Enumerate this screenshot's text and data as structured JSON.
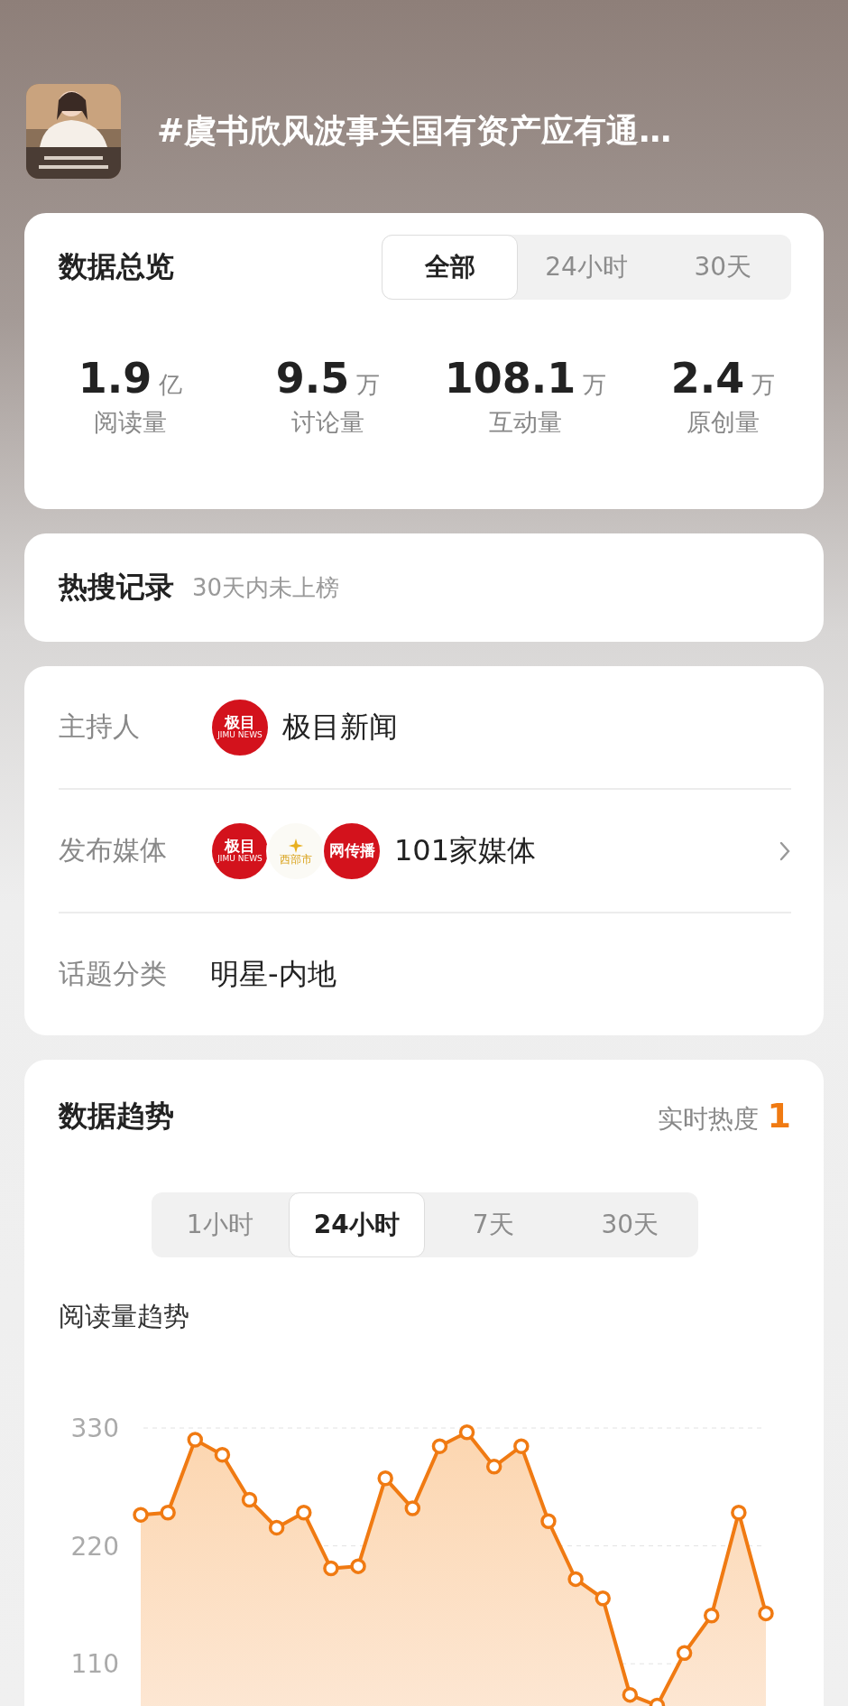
{
  "topic": {
    "title": "#虞书欣风波事关国有资产应有通…"
  },
  "overview": {
    "title": "数据总览",
    "tabs": [
      {
        "label": "全部",
        "selected": true
      },
      {
        "label": "24小时",
        "selected": false
      },
      {
        "label": "30天",
        "selected": false
      }
    ],
    "stats": [
      {
        "value": "1.9",
        "unit": "亿",
        "label": "阅读量"
      },
      {
        "value": "9.5",
        "unit": "万",
        "label": "讨论量"
      },
      {
        "value": "108.1",
        "unit": "万",
        "label": "互动量"
      },
      {
        "value": "2.4",
        "unit": "万",
        "label": "原创量"
      }
    ]
  },
  "hot_search": {
    "title": "热搜记录",
    "note": "30天内未上榜"
  },
  "info": {
    "rows": [
      {
        "label": "主持人",
        "avatars": [
          {
            "kind": "red",
            "text": "极目",
            "sub": "JIMU NEWS"
          }
        ],
        "value": "极目新闻",
        "chevron": false
      },
      {
        "label": "发布媒体",
        "avatars": [
          {
            "kind": "red",
            "text": "极目",
            "sub": "JIMU NEWS"
          },
          {
            "kind": "white",
            "text": "西部市"
          },
          {
            "kind": "red",
            "text": "网传播"
          }
        ],
        "value": "101家媒体",
        "chevron": true
      },
      {
        "label": "话题分类",
        "value": "明星-内地",
        "chevron": false
      }
    ]
  },
  "trend": {
    "title": "数据趋势",
    "heat_label": "实时热度",
    "heat_value": "1",
    "tabs": [
      {
        "label": "1小时",
        "selected": false
      },
      {
        "label": "24小时",
        "selected": true
      },
      {
        "label": "7天",
        "selected": false
      },
      {
        "label": "30天",
        "selected": false
      }
    ],
    "chart_data": {
      "type": "area",
      "title": "阅读量趋势",
      "categories": [
        null,
        null,
        null,
        null,
        null,
        null,
        null,
        null,
        null,
        null,
        null,
        null,
        null,
        null,
        null,
        null,
        null,
        null,
        null,
        null,
        null,
        null,
        null,
        null
      ],
      "ylim": [
        0,
        330
      ],
      "yticks": [
        110,
        220,
        330
      ],
      "series": [
        {
          "color": "#f07a12",
          "values": [
            249,
            251,
            319,
            305,
            263,
            237,
            251,
            199,
            201,
            283,
            255,
            313,
            326,
            294,
            313,
            243,
            189,
            171,
            81,
            71,
            120,
            155,
            251,
            157
          ]
        }
      ]
    }
  }
}
